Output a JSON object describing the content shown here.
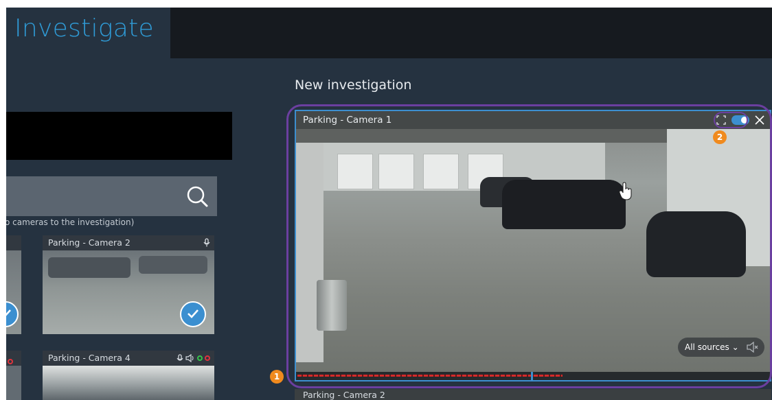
{
  "header": {
    "tab_title": "Investigate"
  },
  "left_panel": {
    "search": {
      "placeholder": "",
      "icon": "search-icon"
    },
    "hint_text": "o cameras to the investigation)",
    "cameras": [
      {
        "title": "Parking - Camera 2",
        "icons": [
          "microphone-icon"
        ],
        "selected": true
      },
      {
        "title": "Parking - Camera 4",
        "icons": [
          "microphone-icon",
          "speaker-icon",
          "status-green-icon",
          "status-red-icon"
        ],
        "selected": false
      }
    ]
  },
  "main": {
    "section_title": "New investigation",
    "video": {
      "title": "Parking - Camera 1",
      "sources_label": "All sources",
      "toggle_on": true
    },
    "next_camera_title": "Parking - Camera 2",
    "badges": [
      "1",
      "2"
    ]
  },
  "colors": {
    "accent": "#3c8fd0",
    "highlight_outline": "#6b3fa0",
    "badge": "#f08a1e",
    "background": "#253240"
  }
}
